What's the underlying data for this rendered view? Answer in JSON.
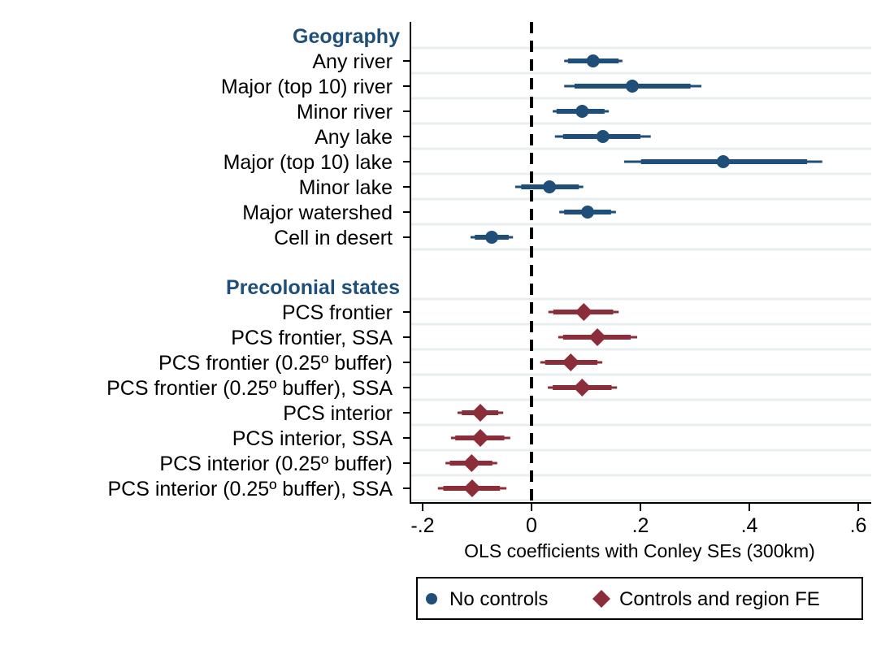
{
  "chart_data": {
    "type": "scatter",
    "subtype": "coefficient-plot",
    "title": "",
    "xlabel": "OLS coefficients with Conley SEs (300km)",
    "ylabel": "",
    "xlim": [
      -0.22,
      0.62
    ],
    "xticks": [
      -0.2,
      0,
      0.2,
      0.4,
      0.6
    ],
    "xtick_labels": [
      "-.2",
      "0",
      ".2",
      ".4",
      ".6"
    ],
    "reference_line": {
      "x": 0,
      "style": "dashed"
    },
    "grid": true,
    "legend_position": "bottom",
    "series": [
      {
        "name": "No controls",
        "marker": "circle",
        "color": "#1f4e79"
      },
      {
        "name": "Controls and region FE",
        "marker": "diamond",
        "color": "#8b2e3a"
      }
    ],
    "groups": [
      {
        "header": "Geography",
        "header_color": "#1f4e79",
        "series": "No controls",
        "rows": [
          {
            "label": "Any river",
            "estimate": 0.113,
            "ci90": [
              0.067,
              0.16
            ],
            "ci95": [
              0.06,
              0.167
            ]
          },
          {
            "label": "Major (top 10) river",
            "estimate": 0.185,
            "ci90": [
              0.079,
              0.292
            ],
            "ci95": [
              0.06,
              0.312
            ]
          },
          {
            "label": "Minor river",
            "estimate": 0.093,
            "ci90": [
              0.046,
              0.134
            ],
            "ci95": [
              0.039,
              0.142
            ]
          },
          {
            "label": "Any lake",
            "estimate": 0.131,
            "ci90": [
              0.058,
              0.2
            ],
            "ci95": [
              0.043,
              0.219
            ]
          },
          {
            "label": "Major (top 10) lake",
            "estimate": 0.352,
            "ci90": [
              0.201,
              0.506
            ],
            "ci95": [
              0.17,
              0.534
            ]
          },
          {
            "label": "Minor lake",
            "estimate": 0.033,
            "ci90": [
              -0.019,
              0.087
            ],
            "ci95": [
              -0.03,
              0.095
            ]
          },
          {
            "label": "Major watershed",
            "estimate": 0.103,
            "ci90": [
              0.06,
              0.146
            ],
            "ci95": [
              0.051,
              0.155
            ]
          },
          {
            "label": "Cell in desert",
            "estimate": -0.073,
            "ci90": [
              -0.104,
              -0.042
            ],
            "ci95": [
              -0.112,
              -0.034
            ]
          }
        ]
      },
      {
        "header": "Precolonial states",
        "header_color": "#1f4e79",
        "series": "Controls and region FE",
        "rows": [
          {
            "label": "PCS frontier",
            "estimate": 0.096,
            "ci90": [
              0.04,
              0.15
            ],
            "ci95": [
              0.031,
              0.16
            ]
          },
          {
            "label": "PCS frontier, SSA",
            "estimate": 0.121,
            "ci90": [
              0.058,
              0.182
            ],
            "ci95": [
              0.049,
              0.194
            ]
          },
          {
            "label": "PCS frontier (0.25º buffer)",
            "estimate": 0.072,
            "ci90": [
              0.025,
              0.121
            ],
            "ci95": [
              0.016,
              0.13
            ]
          },
          {
            "label": "PCS frontier (0.25º buffer), SSA",
            "estimate": 0.093,
            "ci90": [
              0.039,
              0.147
            ],
            "ci95": [
              0.03,
              0.157
            ]
          },
          {
            "label": "PCS interior",
            "estimate": -0.094,
            "ci90": [
              -0.128,
              -0.061
            ],
            "ci95": [
              -0.136,
              -0.052
            ]
          },
          {
            "label": "PCS interior, SSA",
            "estimate": -0.094,
            "ci90": [
              -0.14,
              -0.05
            ],
            "ci95": [
              -0.148,
              -0.039
            ]
          },
          {
            "label": "PCS interior (0.25º buffer)",
            "estimate": -0.11,
            "ci90": [
              -0.15,
              -0.072
            ],
            "ci95": [
              -0.158,
              -0.063
            ]
          },
          {
            "label": "PCS interior (0.25º buffer), SSA",
            "estimate": -0.109,
            "ci90": [
              -0.162,
              -0.058
            ],
            "ci95": [
              -0.172,
              -0.046
            ]
          }
        ]
      }
    ]
  },
  "legend": {
    "items": [
      {
        "label": "No controls"
      },
      {
        "label": "Controls and region FE"
      }
    ]
  }
}
